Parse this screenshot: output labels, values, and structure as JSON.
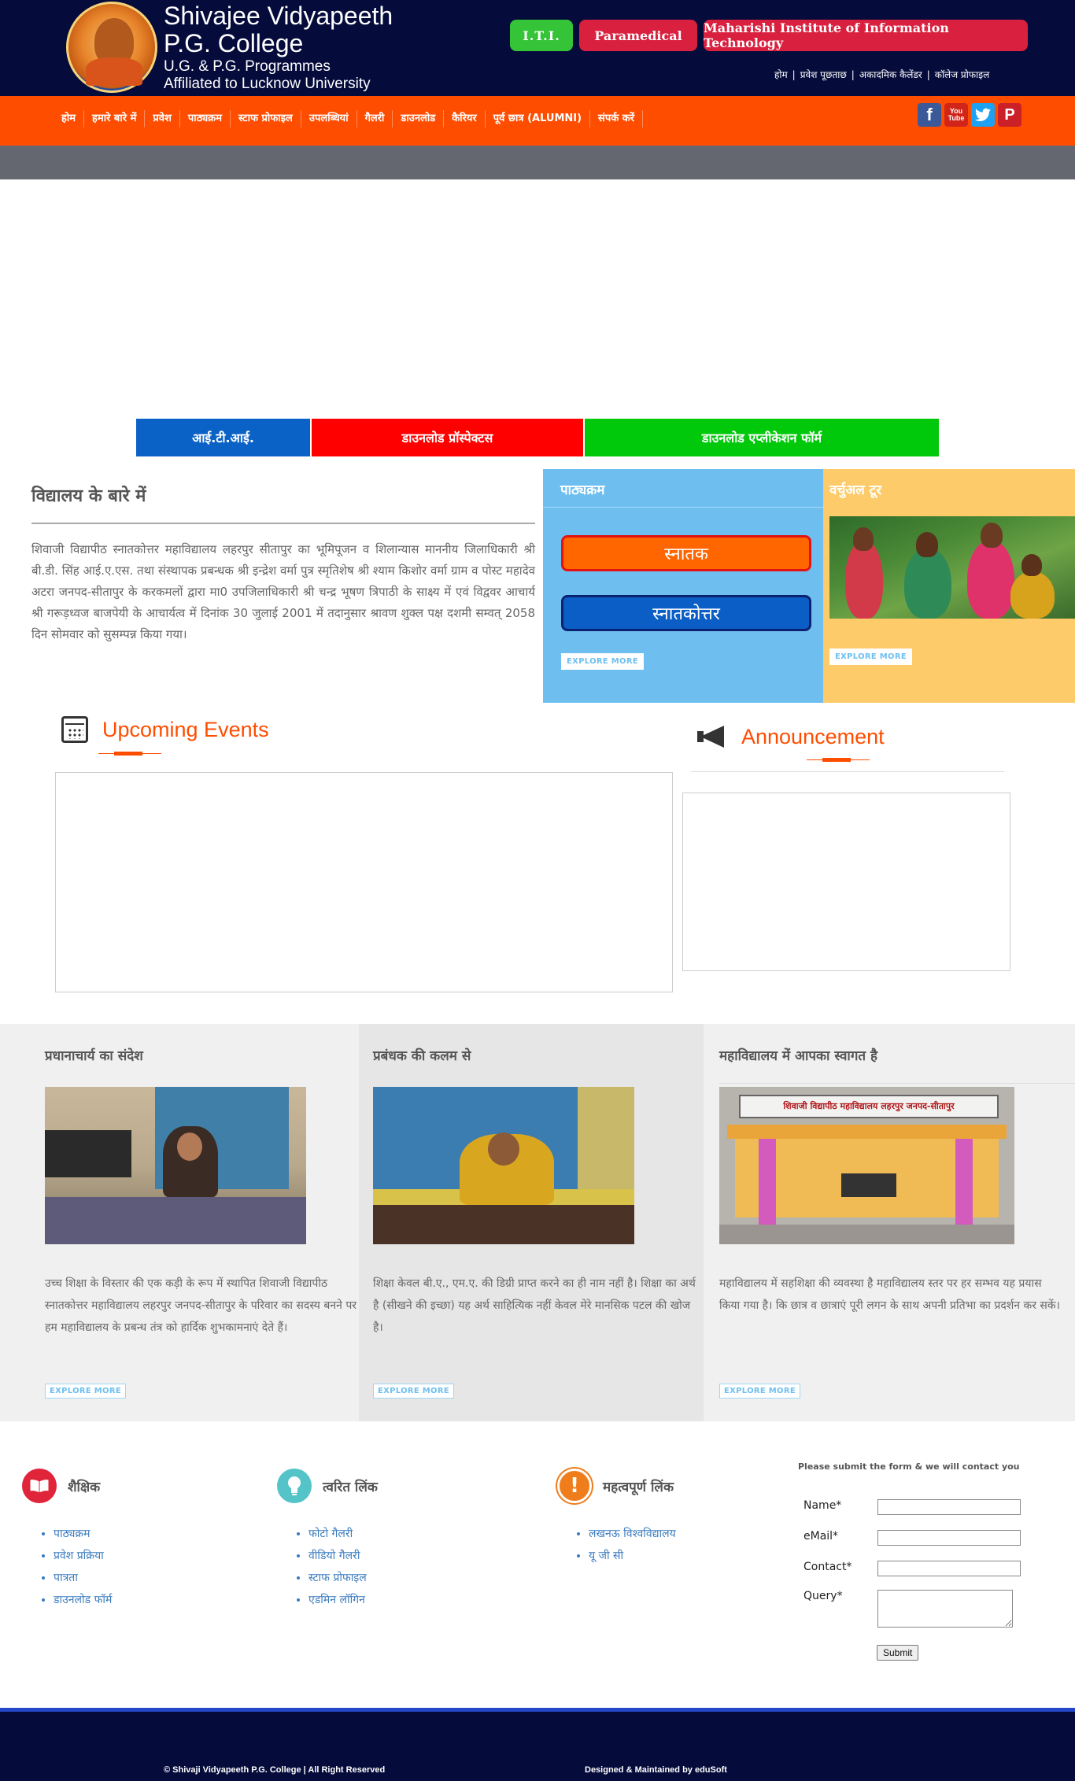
{
  "header": {
    "logo_lines": [
      "Shivajee Vidyapeeth",
      "P.G. College",
      "U.G. & P.G. Programmes",
      "Affiliated to Lucknow University"
    ],
    "top_buttons": [
      "I.T.I.",
      "Paramedical",
      "Maharishi Institute of Information Technology"
    ],
    "top_links": [
      "होम",
      "प्रवेश पूछताछ",
      "अकादमिक कैलेंडर",
      "कॉलेज प्रोफाइल"
    ]
  },
  "nav": {
    "items": [
      "होम",
      "हमारे बारे में",
      "प्रवेश",
      "पाठ्यक्रम",
      "स्टाफ प्रोफाइल",
      "उपलब्धियां",
      "गैलरी",
      "डाउनलोड",
      "कैरियर",
      "पूर्व छात्र (ALUMNI)",
      "संपर्क करें"
    ],
    "social": [
      "f",
      "You Tube",
      "t",
      "P"
    ]
  },
  "quick_buttons": [
    "आई.टी.आई.",
    "डाउनलोड प्रॉस्पेक्टस",
    "डाउनलोड एप्लीकेशन फॉर्म"
  ],
  "about": {
    "title": "विद्यालय के बारे में",
    "text": "शिवाजी विद्यापीठ स्नातकोत्तर महाविद्यालय लहरपुर सीतापुर का भूमिपूजन व शिलान्यास माननीय जिलाधिकारी श्री बी.डी. सिंह आई.ए.एस. तथा संस्थापक प्रबन्धक श्री इन्द्रेश वर्मा पुत्र स्मृतिशेष श्री श्याम किशोर वर्मा ग्राम व पोस्ट महादेव अटरा जनपद-सीतापुर के करकमलों द्वारा मा0 उपजिलाधिकारी श्री चन्द्र भूषण त्रिपाठी के साक्ष्य में एवं विद्ववर आचार्य श्री गरूड़ध्वज बाजपेयी के आचार्यत्व में दिनांक 30 जुलाई 2001 में तदानुसार श्रावण शुक्ल पक्ष दशमी सम्वत् 2058 दिन सोमवार को सुसम्पन्न किया गया।"
  },
  "courses": {
    "title": "पाठ्यक्रम",
    "buttons": [
      "स्नातक",
      "स्नातकोत्तर"
    ],
    "explore": "EXPLORE MORE"
  },
  "tour": {
    "title": "वर्चुअल टूर",
    "explore": "EXPLORE MORE"
  },
  "events": {
    "title": "Upcoming Events"
  },
  "announcement": {
    "title": "Announcement"
  },
  "messages": [
    {
      "title": "प्रधानाचार्य का संदेश",
      "text": "उच्च शिक्षा के विस्तार की एक कड़ी के रूप में स्थापित शिवाजी विद्यापीठ स्नातकोत्तर महाविद्यालय लहरपुर जनपद-सीतापुर के परिवार का सदस्य बनने पर हम महाविद्यालय के प्रबन्ध तंत्र को हार्दिक शुभकामनाएं देते हैं।",
      "explore": "EXPLORE MORE"
    },
    {
      "title": "प्रबंधक की कलम से",
      "text": "शिक्षा केवल बी.ए., एम.ए. की डिग्री प्राप्त करने का ही नाम नहीं है। शिक्षा का अर्थ है (सीखने की इच्छा) यह अर्थ साहित्यिक नहीं केवल मेरे मानसिक पटल की खोज है।",
      "explore": "EXPLORE MORE"
    },
    {
      "title": "महाविद्यालय में आपका स्वागत है",
      "text": "महाविद्यालय में सहशिक्षा की व्यवस्था है महाविद्यालय स्तर पर हर सम्भव यह प्रयास किया गया है। कि छात्र व छात्राएं पूरी लगन के साथ अपनी प्रतिभा का प्रदर्शन कर सकें।",
      "explore": "EXPLORE MORE",
      "sign_text": "शिवाजी विद्यापीठ महाविद्यालय लहरपुर जनपद-सीतापुर"
    }
  ],
  "footer": {
    "academic": {
      "title": "शैक्षिक",
      "links": [
        "पाठ्यक्रम",
        "प्रवेश प्रक्रिया",
        "पात्रता",
        "डाउनलोड फॉर्म"
      ]
    },
    "quick": {
      "title": "त्वरित लिंक",
      "links": [
        "फोटो गैलरी",
        "वीडियो गैलरी",
        "स्टाफ प्रोफाइल",
        "एडमिन लॉगिन"
      ]
    },
    "important": {
      "title": "महत्वपूर्ण लिंक",
      "links": [
        "लखनऊ विश्वविद्यालय",
        "यू जी सी"
      ]
    },
    "form": {
      "note": "Please submit the form & we will contact you",
      "labels": [
        "Name*",
        "eMail*",
        "Contact*",
        "Query*"
      ],
      "submit": "Submit"
    },
    "copyright": "© Shivaji Vidyapeeth P.G. College | All Right Reserved",
    "designed": "Designed & Maintained by eduSoft"
  },
  "colors": {
    "header_bg": "#050b3b",
    "nav_bg": "#ff4d00",
    "accent_orange": "#ff4d00",
    "courses_bg": "#6ebff0",
    "tour_bg": "#fecb6a"
  }
}
